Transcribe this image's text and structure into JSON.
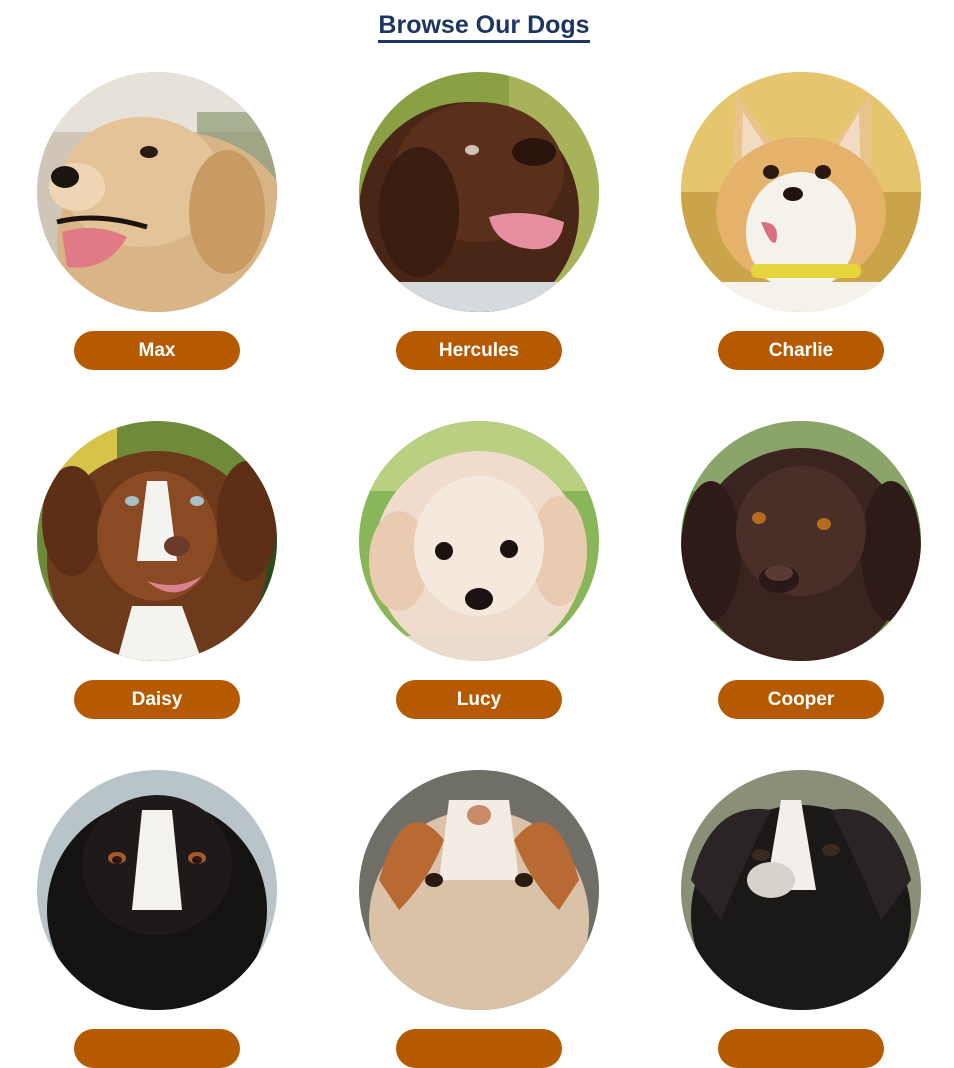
{
  "page": {
    "title": "Browse Our Dogs"
  },
  "colors": {
    "title": "#1e3461",
    "button": "#b55a00",
    "button_text": "#ffffff"
  },
  "dogs": [
    {
      "name": "Max",
      "breed_icon": "golden-retriever"
    },
    {
      "name": "Hercules",
      "breed_icon": "newfoundland"
    },
    {
      "name": "Charlie",
      "breed_icon": "corgi"
    },
    {
      "name": "Daisy",
      "breed_icon": "australian-shepherd"
    },
    {
      "name": "Lucy",
      "breed_icon": "poodle-puppy"
    },
    {
      "name": "Cooper",
      "breed_icon": "spaniel"
    },
    {
      "name": "",
      "breed_icon": "bernese-mountain-dog"
    },
    {
      "name": "",
      "breed_icon": "bulldog"
    },
    {
      "name": "",
      "breed_icon": "boxer-mix"
    }
  ]
}
